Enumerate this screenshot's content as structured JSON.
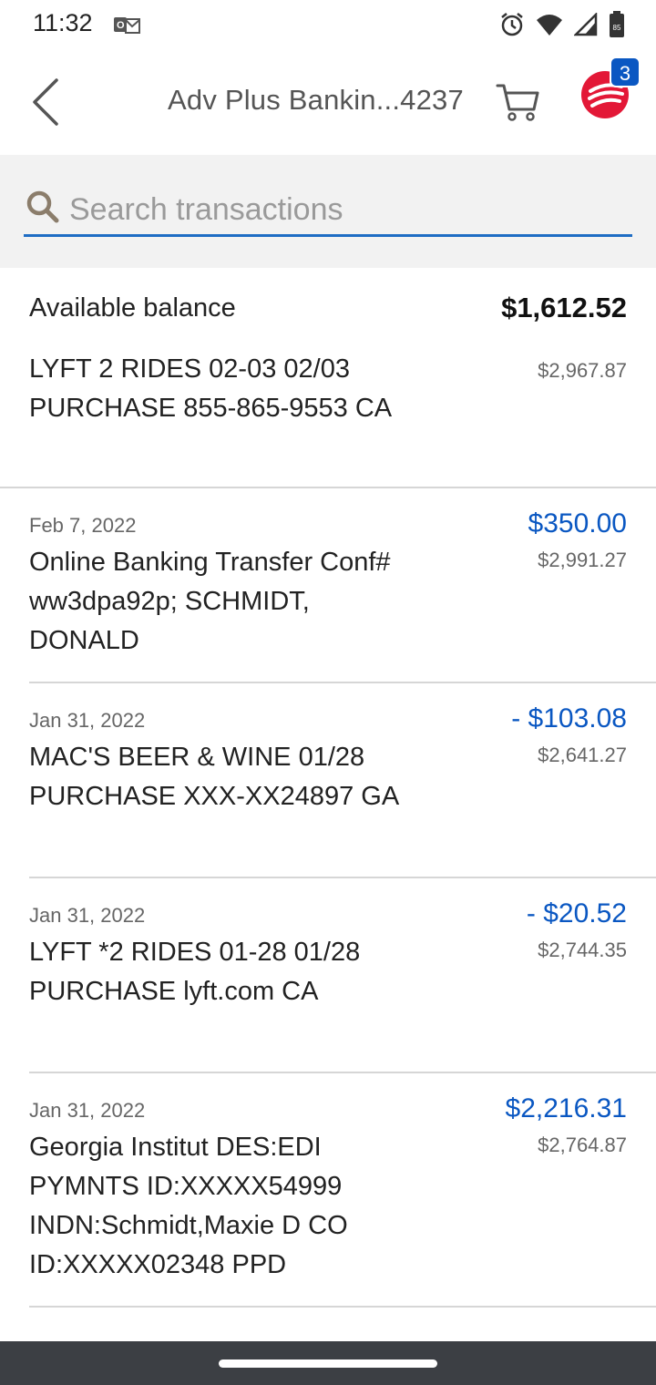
{
  "status_bar": {
    "time": "11:32",
    "battery_level": "85"
  },
  "header": {
    "title": "Adv Plus Bankin...4237",
    "cart_badge": "3",
    "brand_color": "#e31837"
  },
  "search": {
    "placeholder": "Search transactions",
    "value": ""
  },
  "balance": {
    "label": "Available balance",
    "value": "$1,612.52"
  },
  "pending": {
    "description": "LYFT 2 RIDES 02-03 02/03 PURCHASE 855-865-9553 CA",
    "running_balance": "$2,967.87"
  },
  "transactions": [
    {
      "date": "Feb 7, 2022",
      "description": "Online Banking Transfer Conf# ww3dpa92p; SCHMIDT, DONALD",
      "amount": "$350.00",
      "running_balance": "$2,991.27"
    },
    {
      "date": "Jan 31, 2022",
      "description": "MAC'S BEER & WINE 01/28 PURCHASE XXX-XX24897 GA",
      "amount": "- $103.08",
      "running_balance": "$2,641.27"
    },
    {
      "date": "Jan 31, 2022",
      "description": "LYFT *2 RIDES 01-28 01/28 PURCHASE lyft.com CA",
      "amount": "- $20.52",
      "running_balance": "$2,744.35"
    },
    {
      "date": "Jan 31, 2022",
      "description": "Georgia Institut DES:EDI PYMNTS ID:XXXXX54999 INDN:Schmidt,Maxie D CO ID:XXXXX02348 PPD",
      "amount": "$2,216.31",
      "running_balance": "$2,764.87"
    }
  ],
  "colors": {
    "accent": "#0a57c2",
    "search_underline": "#1f6dc4",
    "nav_bar": "#3c3f44"
  }
}
